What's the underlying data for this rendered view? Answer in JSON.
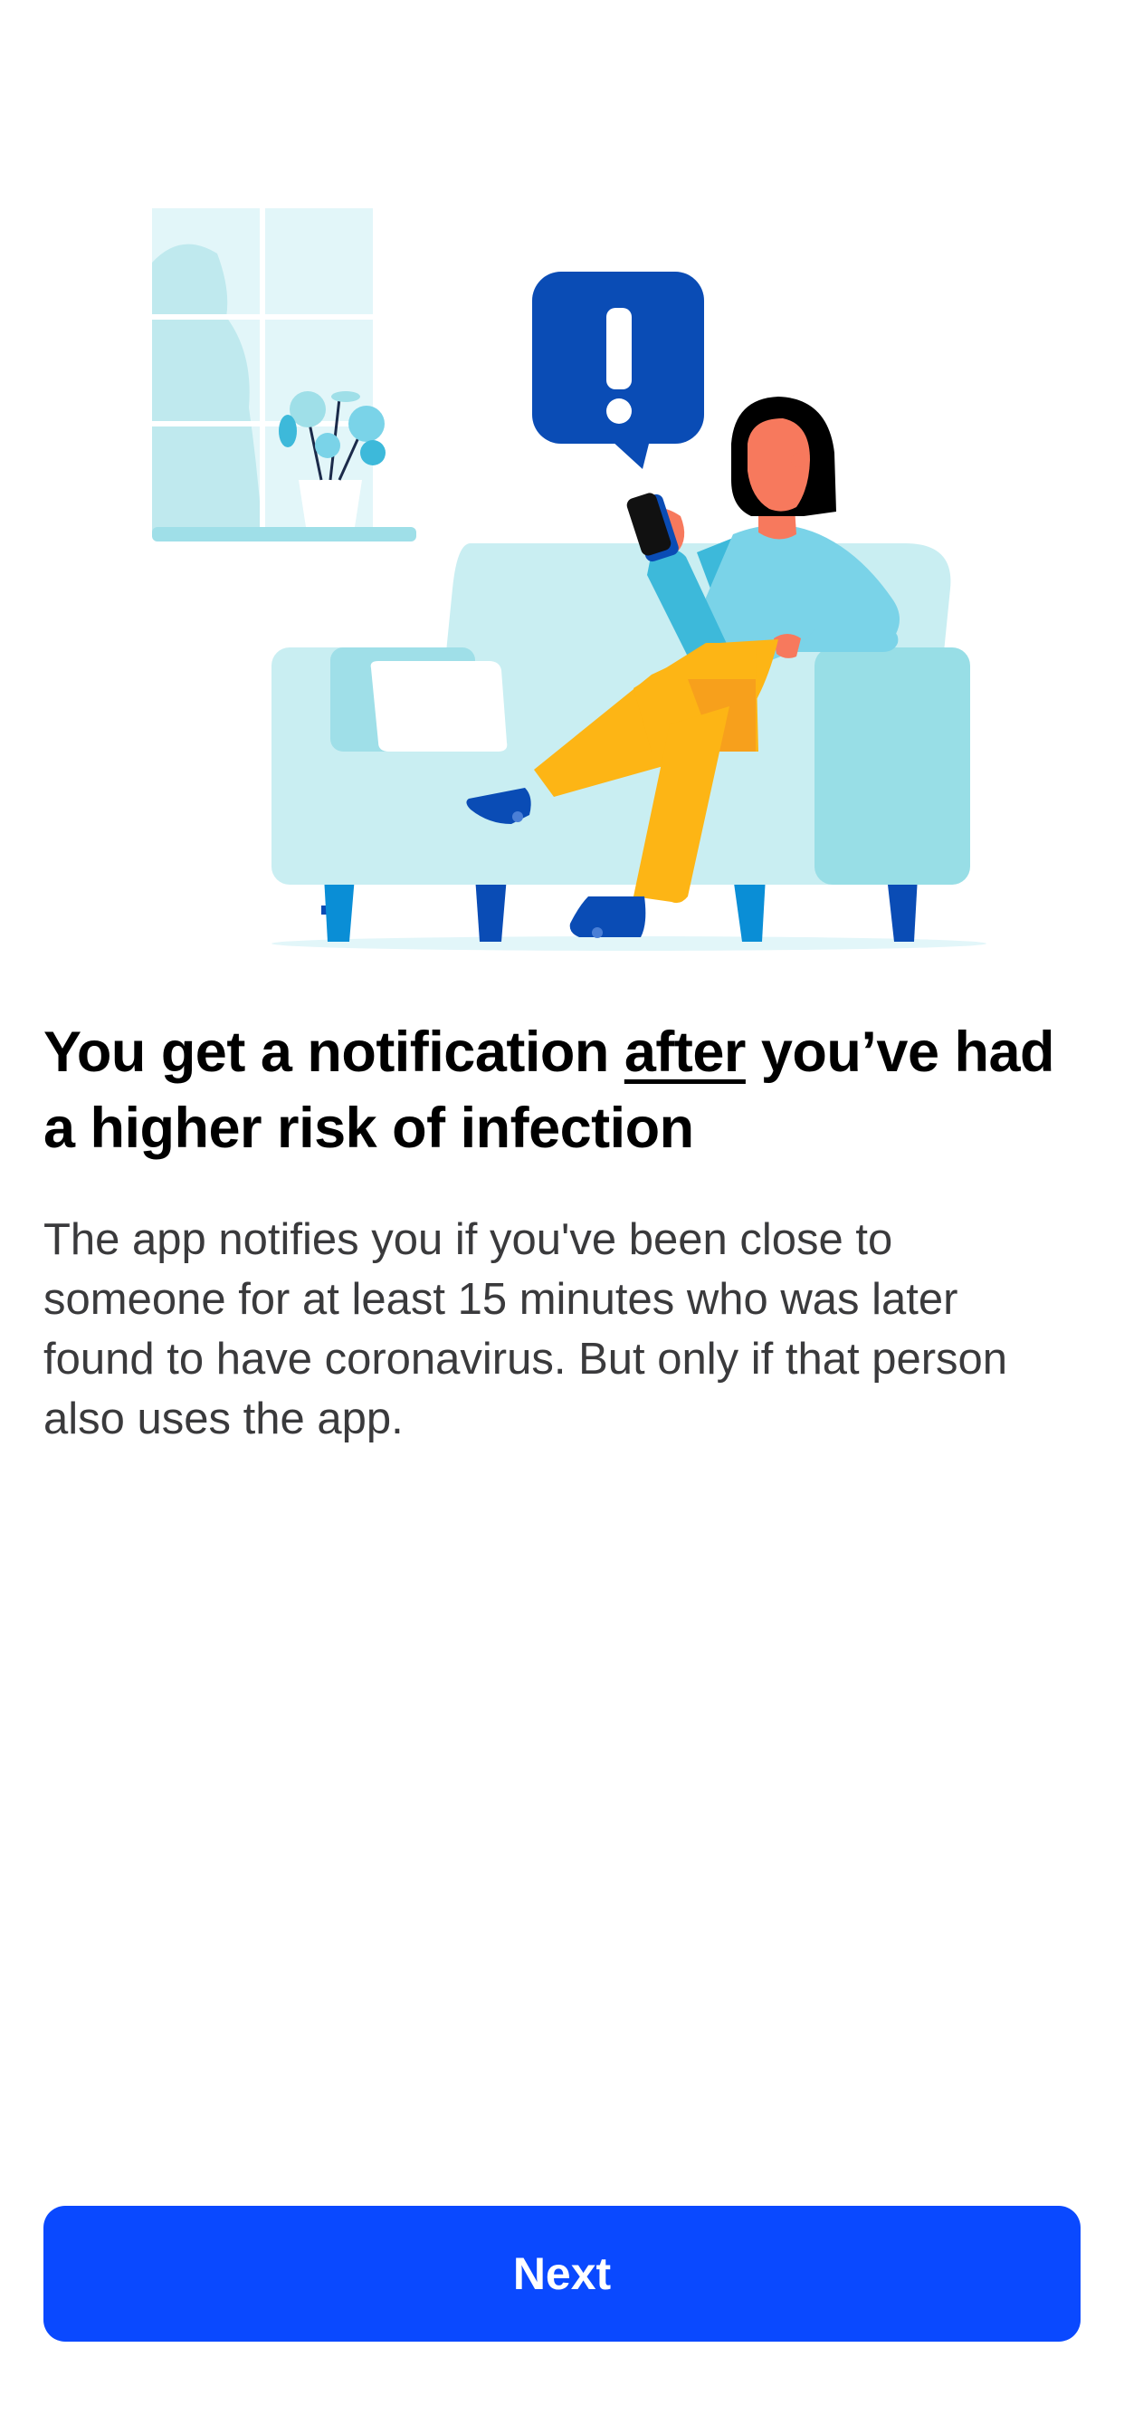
{
  "heading": {
    "part1": "You get a notification ",
    "emphasis": "after",
    "part2": " you’ve had a higher risk of infection"
  },
  "body": "The app notifies you if you've been close to someone for at least 15 minutes who was later found to have coronavirus. But only if that person also uses the app.",
  "next_button": {
    "label": "Next"
  },
  "colors": {
    "accent": "#0a49ff",
    "notification_bubble": "#0a4cb5",
    "sofa": "#c9eef2",
    "pants": "#fdb515",
    "shirt": "#7ad3e8",
    "skin": "#f7795d"
  }
}
